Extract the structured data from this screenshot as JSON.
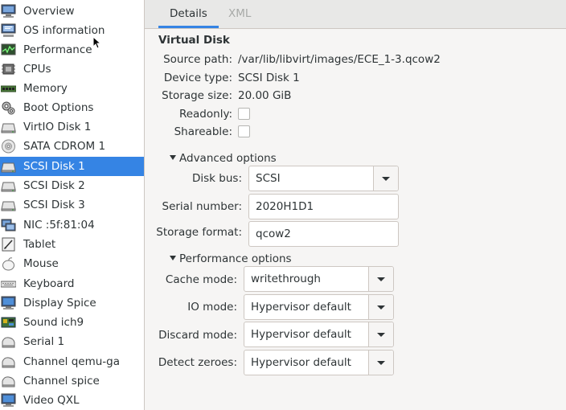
{
  "sidebar": {
    "items": [
      {
        "label": "Overview",
        "icon": "monitor-icon"
      },
      {
        "label": "OS information",
        "icon": "monitor-info-icon"
      },
      {
        "label": "Performance",
        "icon": "performance-graph-icon"
      },
      {
        "label": "CPUs",
        "icon": "cpu-chip-icon"
      },
      {
        "label": "Memory",
        "icon": "memory-stick-icon"
      },
      {
        "label": "Boot Options",
        "icon": "gears-icon"
      },
      {
        "label": "VirtIO Disk 1",
        "icon": "hard-disk-icon"
      },
      {
        "label": "SATA CDROM 1",
        "icon": "cdrom-icon"
      },
      {
        "label": "SCSI Disk 1",
        "icon": "hard-disk-icon",
        "selected": true
      },
      {
        "label": "SCSI Disk 2",
        "icon": "hard-disk-icon"
      },
      {
        "label": "SCSI Disk 3",
        "icon": "hard-disk-icon"
      },
      {
        "label": "NIC :5f:81:04",
        "icon": "network-icon"
      },
      {
        "label": "Tablet",
        "icon": "tablet-icon"
      },
      {
        "label": "Mouse",
        "icon": "mouse-icon"
      },
      {
        "label": "Keyboard",
        "icon": "keyboard-icon"
      },
      {
        "label": "Display Spice",
        "icon": "display-icon"
      },
      {
        "label": "Sound ich9",
        "icon": "sound-card-icon"
      },
      {
        "label": "Serial 1",
        "icon": "serial-port-icon"
      },
      {
        "label": "Channel qemu-ga",
        "icon": "channel-icon"
      },
      {
        "label": "Channel spice",
        "icon": "channel-icon"
      },
      {
        "label": "Video QXL",
        "icon": "video-card-icon"
      }
    ],
    "selected_color": "#3584e4"
  },
  "tabs": {
    "details": "Details",
    "xml": "XML"
  },
  "virtual_disk": {
    "title": "Virtual Disk",
    "source_path_label": "Source path:",
    "source_path": "/var/lib/libvirt/images/ECE_1-3.qcow2",
    "device_type_label": "Device type:",
    "device_type": "SCSI Disk 1",
    "storage_size_label": "Storage size:",
    "storage_size": "20.00 GiB",
    "readonly_label": "Readonly:",
    "readonly_checked": false,
    "shareable_label": "Shareable:",
    "shareable_checked": false
  },
  "advanced": {
    "title": "Advanced options",
    "disk_bus_label": "Disk bus:",
    "disk_bus": "SCSI",
    "serial_label": "Serial number:",
    "serial": "2020H1D1",
    "format_label": "Storage format:",
    "format": "qcow2"
  },
  "performance": {
    "title": "Performance options",
    "cache_label": "Cache mode:",
    "cache": "writethrough",
    "io_label": "IO mode:",
    "io": "Hypervisor default",
    "discard_label": "Discard mode:",
    "discard": "Hypervisor default",
    "zeroes_label": "Detect zeroes:",
    "zeroes": "Hypervisor default"
  }
}
